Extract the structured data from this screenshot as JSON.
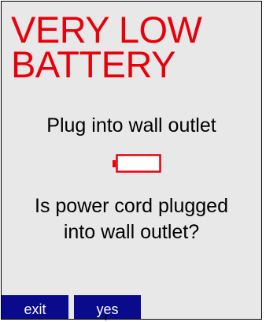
{
  "alert": {
    "title_line1": "VERY LOW",
    "title_line2": "BATTERY",
    "instruction": "Plug into wall outlet",
    "question_line1": "Is power cord plugged",
    "question_line2": "into wall outlet?",
    "battery_icon": "empty-battery-icon"
  },
  "softkeys": {
    "exit": "exit",
    "yes": "yes"
  },
  "colors": {
    "title": "#e8000a",
    "battery": "#e8000a",
    "softkey_bg": "#0a0a8c",
    "screen_bg": "#e8e8e8"
  }
}
